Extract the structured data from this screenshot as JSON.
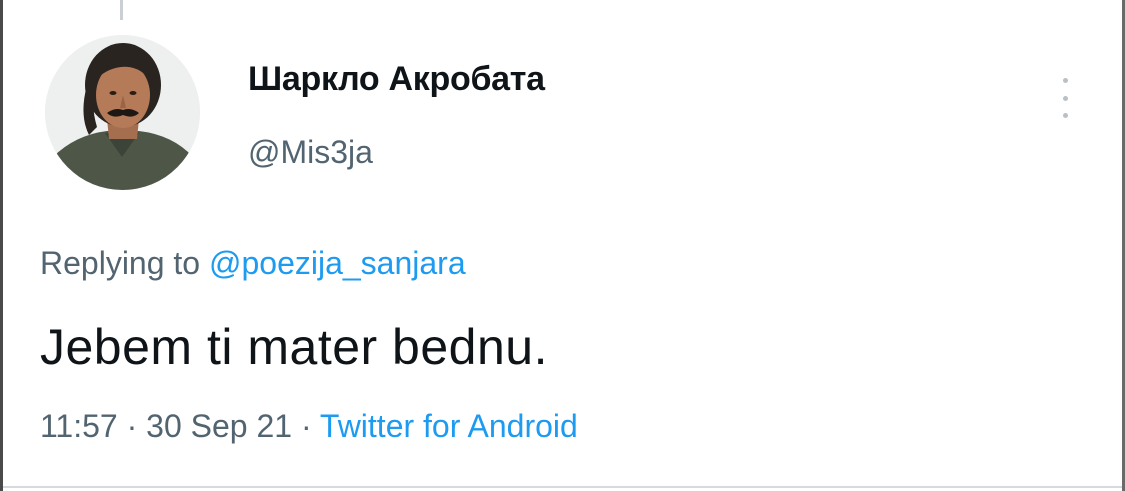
{
  "tweet": {
    "author": {
      "display_name": "Шаркло Акробата",
      "handle": "@Mis3ja",
      "avatar_icon": "profile-photo"
    },
    "more_icon": "vertical-ellipsis-icon",
    "reply_prefix": "Replying to",
    "reply_to": "@poezija_sanjara",
    "text": "Jebem ti mater bednu.",
    "time": "11:57",
    "separator": "·",
    "date": "30 Sep 21",
    "source": "Twitter for Android"
  },
  "colors": {
    "primary_text": "#0f1419",
    "secondary_text": "#536471",
    "link": "#1d9bf0"
  }
}
